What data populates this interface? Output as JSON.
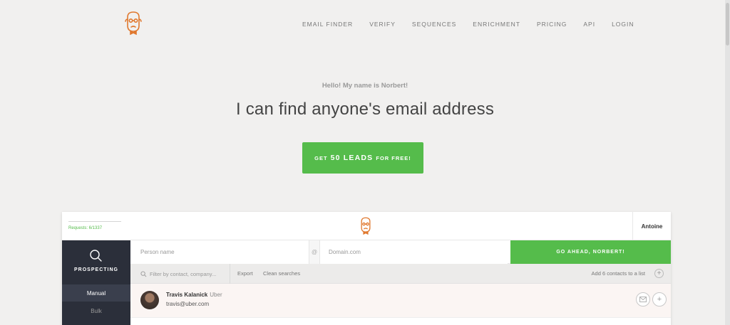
{
  "nav": {
    "items": [
      "EMAIL FINDER",
      "VERIFY",
      "SEQUENCES",
      "ENRICHMENT",
      "PRICING",
      "API",
      "LOGIN"
    ]
  },
  "hero": {
    "greeting": "Hello! My name is Norbert!",
    "headline": "I can find anyone's email address",
    "cta": {
      "prefix": "GET",
      "highlight": "50 LEADS",
      "suffix": "FOR FREE!"
    }
  },
  "app": {
    "requests": "Requests: 6/1337",
    "user": "Antoine",
    "sidebar": {
      "title": "PROSPECTING",
      "items": [
        "Manual",
        "Bulk"
      ]
    },
    "search": {
      "person_placeholder": "Person name",
      "at": "@",
      "domain_placeholder": "Domain.com",
      "button": "GO AHEAD, NORBERT!"
    },
    "toolbar": {
      "filter_placeholder": "Filter by contact, company...",
      "export": "Export",
      "clean": "Clean searches",
      "add_to_list": "Add 6 contacts to a list"
    },
    "contacts": [
      {
        "name": "Travis Kalanick",
        "company": "Uber",
        "email": "travis@uber.com"
      }
    ]
  },
  "colors": {
    "accent": "#55bc4b",
    "sidebar": "#2b2f3a",
    "logo": "#e0782e"
  }
}
